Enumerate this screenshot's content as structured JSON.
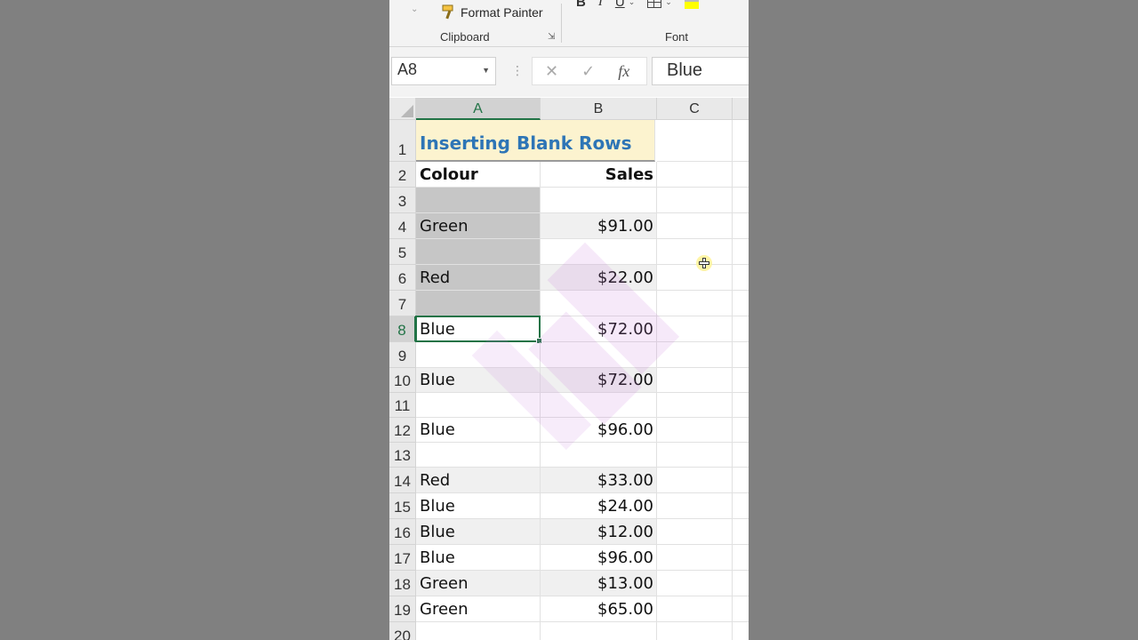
{
  "ribbon": {
    "format_painter_label": "Format Painter",
    "clipboard_label": "Clipboard",
    "font_label": "Font",
    "bold_label": "B",
    "italic_label": "I",
    "underline_label": "U"
  },
  "formula_bar": {
    "name_box": "A8",
    "value": "Blue",
    "fx_label": "fx"
  },
  "columns": [
    "A",
    "B",
    "C"
  ],
  "title": "Inserting Blank Rows",
  "header": {
    "colour": "Colour",
    "sales": "Sales"
  },
  "rows": [
    {
      "num": "1",
      "a": "",
      "b": ""
    },
    {
      "num": "2",
      "a": "",
      "b": ""
    },
    {
      "num": "3",
      "a": "",
      "b": ""
    },
    {
      "num": "4",
      "a": "Green",
      "b": "$91.00"
    },
    {
      "num": "5",
      "a": "",
      "b": ""
    },
    {
      "num": "6",
      "a": "Red",
      "b": "$22.00"
    },
    {
      "num": "7",
      "a": "",
      "b": ""
    },
    {
      "num": "8",
      "a": "Blue",
      "b": "$72.00"
    },
    {
      "num": "9",
      "a": "",
      "b": ""
    },
    {
      "num": "10",
      "a": "Blue",
      "b": "$72.00"
    },
    {
      "num": "11",
      "a": "",
      "b": ""
    },
    {
      "num": "12",
      "a": "Blue",
      "b": "$96.00"
    },
    {
      "num": "13",
      "a": "",
      "b": ""
    },
    {
      "num": "14",
      "a": "Red",
      "b": "$33.00"
    },
    {
      "num": "15",
      "a": "Blue",
      "b": "$24.00"
    },
    {
      "num": "16",
      "a": "Blue",
      "b": "$12.00"
    },
    {
      "num": "17",
      "a": "Blue",
      "b": "$96.00"
    },
    {
      "num": "18",
      "a": "Green",
      "b": "$13.00"
    },
    {
      "num": "19",
      "a": "Green",
      "b": "$65.00"
    },
    {
      "num": "20",
      "a": "",
      "b": ""
    }
  ]
}
